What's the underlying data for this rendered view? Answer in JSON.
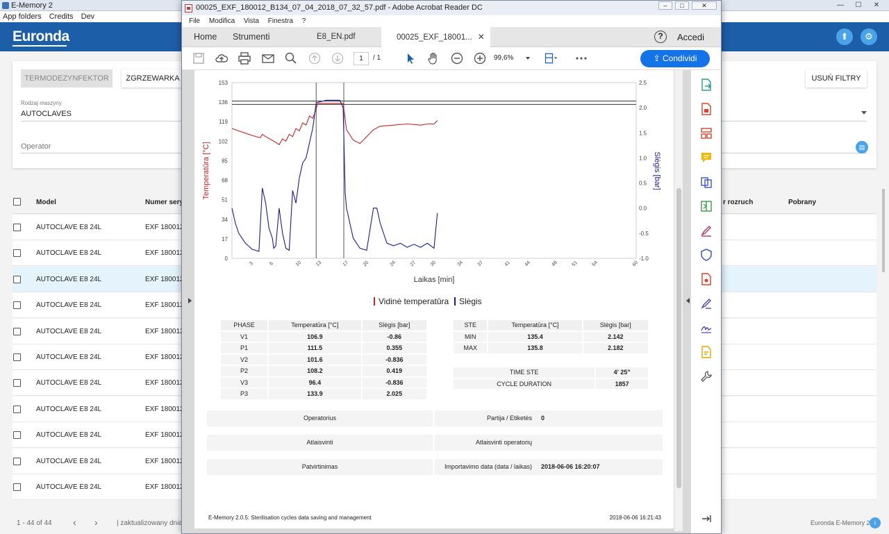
{
  "bg_app": {
    "title": "E-Memory 2",
    "menu": [
      "App folders",
      "Credits",
      "Dev"
    ],
    "logo": "Euronda",
    "filters": {
      "chip_1": "TERMODEZYNFEKTOR",
      "chip_2": "ZGRZEWARKA",
      "clear_button": "USUŃ FILTRY",
      "machine_type_label": "Rodzaj maszyny",
      "machine_type_value": "AUTOCLAVES",
      "operator_placeholder": "Operator"
    },
    "table": {
      "headers": {
        "model": "Model",
        "serial": "Numer seryj",
        "start": "r rozruch",
        "downloaded": "Pobrany"
      },
      "rows": [
        {
          "model": "AUTOCLAVE E8 24L",
          "serial": "EXF 180012"
        },
        {
          "model": "AUTOCLAVE E8 24L",
          "serial": "EXF 180012"
        },
        {
          "model": "AUTOCLAVE E8 24L",
          "serial": "EXF 180012"
        },
        {
          "model": "AUTOCLAVE E8 24L",
          "serial": "EXF 180012"
        },
        {
          "model": "AUTOCLAVE E8 24L",
          "serial": "EXF 180012"
        },
        {
          "model": "AUTOCLAVE E8 24L",
          "serial": "EXF 180012"
        },
        {
          "model": "AUTOCLAVE E8 24L",
          "serial": "EXF 180012"
        },
        {
          "model": "AUTOCLAVE E8 24L",
          "serial": "EXF 180012"
        },
        {
          "model": "AUTOCLAVE E8 24L",
          "serial": "EXF 180012"
        },
        {
          "model": "AUTOCLAVE E8 24L",
          "serial": "EXF 180012"
        },
        {
          "model": "AUTOCLAVE E8 24L",
          "serial": "EXF 180012"
        }
      ],
      "selected_index": 2
    },
    "pager": {
      "range": "1 - 44 of 44",
      "updated": "| zaktualizowany dnia",
      "brand": "Euronda E-Memory 2"
    }
  },
  "acrobat": {
    "title": "00025_EXF_180012_B134_07_04_2018_07_32_57.pdf - Adobe Acrobat Reader DC",
    "menu": [
      "File",
      "Modifica",
      "Vista",
      "Finestra",
      "?"
    ],
    "tabs": {
      "home": "Home",
      "tools": "Strumenti",
      "doc1": "E8_EN.pdf",
      "doc2": "00025_EXF_18001..."
    },
    "sign_in": "Accedi",
    "page_current": "1",
    "page_total": "/ 1",
    "zoom": "99,6%",
    "share": "Condividi"
  },
  "report": {
    "legend": {
      "temp": "Vidinė temperatūra",
      "pressure": "Slėgis"
    },
    "phase_table": {
      "headers": [
        "PHASE",
        "Temperatūra [°C]",
        "Slėgis [bar]"
      ],
      "rows": [
        [
          "V1",
          "106.9",
          "-0.86"
        ],
        [
          "P1",
          "111.5",
          "0.355"
        ],
        [
          "V2",
          "101.6",
          "-0.836"
        ],
        [
          "P2",
          "108.2",
          "0.419"
        ],
        [
          "V3",
          "96.4",
          "-0.836"
        ],
        [
          "P3",
          "133.9",
          "2.025"
        ]
      ]
    },
    "ste_table": {
      "headers": [
        "STE",
        "Temperatūra [°C]",
        "Slėgis [bar]"
      ],
      "rows": [
        [
          "MIN",
          "135.4",
          "2.142"
        ],
        [
          "MAX",
          "135.8",
          "2.182"
        ]
      ]
    },
    "time_table": {
      "rows": [
        [
          "TIME STE",
          "4' 25\""
        ],
        [
          "CYCLE DURATION",
          "1857"
        ]
      ]
    },
    "info": {
      "operator_label": "Operatorius",
      "batch_label": "Partija / Etiketės",
      "batch_value": "0",
      "release_label": "Atlaisvinti",
      "release_op_label": "Atlaisvinti operatorių",
      "confirm_label": "Patvirtinimas",
      "import_label": "Importavimo data (data / laikas)",
      "import_value": "2018-06-06 16:20:07"
    },
    "footer_left": "E-Memory 2.0.5: Sterilisation cycles data saving and management",
    "footer_right": "2018-06-06 16:21:43"
  },
  "chart_data": {
    "type": "line",
    "xlabel": "Laikas [min]",
    "ylabel": "Temperatūra [°C]",
    "y2label": "Slėgis [bar]",
    "x_ticks": [
      3,
      6,
      10,
      13,
      17,
      20,
      24,
      27,
      30,
      34,
      37,
      41,
      44,
      48,
      51,
      54,
      60
    ],
    "xlim": [
      0,
      60
    ],
    "y_ticks": [
      0,
      17,
      34,
      51,
      68,
      85,
      102,
      119,
      136,
      153
    ],
    "ylim": [
      0,
      153
    ],
    "y2_ticks": [
      -1.0,
      -0.5,
      0,
      0.5,
      1.0,
      1.5,
      2.0,
      2.5
    ],
    "y2lim": [
      -1.0,
      2.5
    ],
    "ref_lines_temp": [
      134,
      137
    ],
    "vlines_min": [
      12.5,
      16.6
    ],
    "colors": {
      "temp": "#cc2222",
      "pressure": "#1a1a99"
    },
    "series": [
      {
        "name": "Vidinė temperatūra",
        "axis": "left",
        "x": [
          0,
          1,
          2,
          3,
          4.2,
          4.5,
          5,
          6.5,
          7,
          7.5,
          8,
          8.5,
          9,
          9.5,
          10,
          10.5,
          11,
          11.5,
          12,
          12.5,
          12.7,
          14,
          16,
          16.5,
          17,
          18,
          19,
          20,
          21,
          22,
          24,
          26,
          28,
          29,
          30,
          30.5
        ],
        "y": [
          113,
          111,
          109,
          107,
          105,
          108,
          106,
          101,
          99,
          104,
          102,
          108,
          106,
          113,
          111,
          118,
          116,
          124,
          122,
          130,
          135,
          135,
          135,
          135,
          112,
          103,
          100,
          106,
          112,
          115,
          116,
          117,
          116,
          117,
          117,
          120
        ]
      },
      {
        "name": "Slėgis",
        "axis": "right",
        "x": [
          0,
          0.5,
          1,
          2,
          3,
          4,
          4.5,
          5,
          5.5,
          6,
          6.2,
          6.5,
          7,
          7.5,
          8,
          8.5,
          9,
          9.5,
          10,
          10.5,
          11,
          11.5,
          12,
          12.5,
          14,
          16,
          16.5,
          16.8,
          17,
          18,
          19,
          20,
          21,
          21.5,
          22,
          23,
          24,
          25,
          26,
          27,
          28,
          29,
          30,
          30.2,
          30.5
        ],
        "y": [
          0,
          -0.3,
          -0.5,
          -0.7,
          -0.82,
          -0.86,
          0.4,
          0.1,
          -0.4,
          -0.6,
          -0.8,
          -0.75,
          0.0,
          -0.5,
          -0.8,
          -0.84,
          0.35,
          0.1,
          0.6,
          0.9,
          1.0,
          1.3,
          1.6,
          2.1,
          2.15,
          2.15,
          2.0,
          0.3,
          0.0,
          -0.6,
          -0.8,
          -0.84,
          0.0,
          0.0,
          -0.3,
          -0.7,
          -0.75,
          -0.7,
          -0.78,
          -0.72,
          -0.78,
          -0.7,
          -0.8,
          -0.5,
          -0.1
        ]
      }
    ]
  }
}
